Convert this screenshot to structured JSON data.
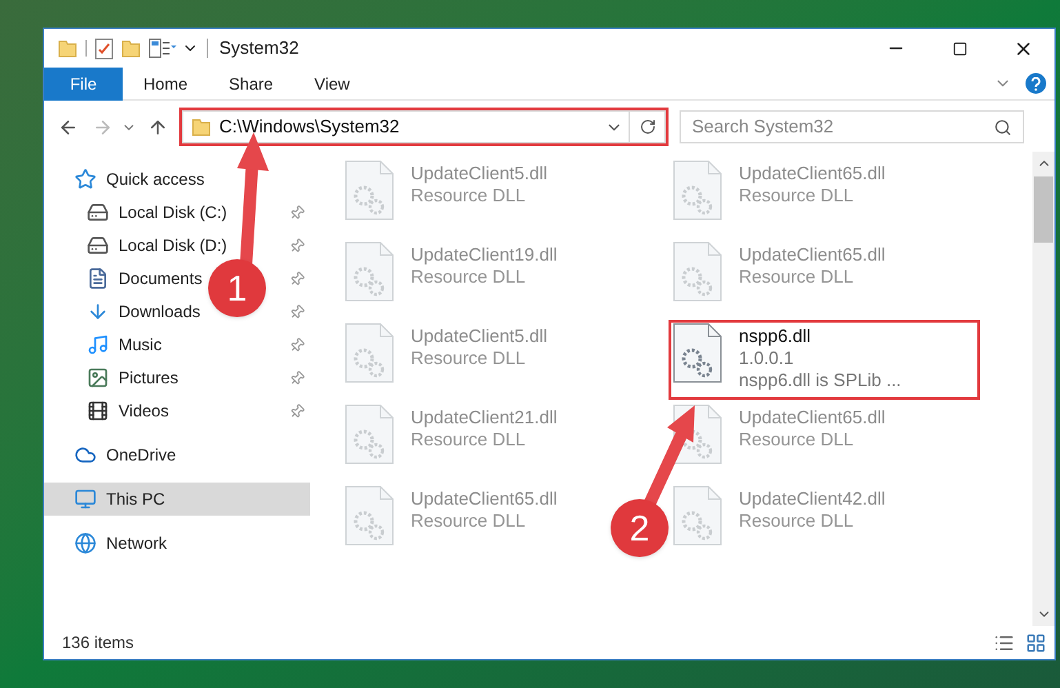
{
  "window": {
    "title": "System32"
  },
  "ribbon_tabs": [
    {
      "label": "File",
      "kind": "file"
    },
    {
      "label": "Home",
      "kind": "tab"
    },
    {
      "label": "Share",
      "kind": "tab"
    },
    {
      "label": "View",
      "kind": "tab"
    }
  ],
  "address_bar": {
    "value": "C:\\Windows\\System32",
    "highlighted": true
  },
  "search": {
    "placeholder": "Search System32"
  },
  "sidebar": {
    "items": [
      {
        "label": "Quick access",
        "kind": "star",
        "selected": false,
        "children": [
          {
            "label": "Local Disk (C:)",
            "kind": "system-drive",
            "pinned": true
          },
          {
            "label": "Local Disk (D:)",
            "kind": "drive",
            "pinned": true
          },
          {
            "label": "Documents",
            "kind": "document",
            "pinned": true
          },
          {
            "label": "Downloads",
            "kind": "download",
            "pinned": true
          },
          {
            "label": "Music",
            "kind": "music",
            "pinned": true
          },
          {
            "label": "Pictures",
            "kind": "picture",
            "pinned": true
          },
          {
            "label": "Videos",
            "kind": "video",
            "pinned": true
          }
        ]
      },
      {
        "label": "OneDrive",
        "kind": "cloud",
        "selected": false
      },
      {
        "label": "This PC",
        "kind": "computer",
        "selected": true
      },
      {
        "label": "Network",
        "kind": "network",
        "selected": false
      }
    ]
  },
  "files": [
    {
      "name": "UpdateClient5.dll",
      "lines": [
        "Resource DLL"
      ],
      "blurred": true,
      "highlighted": false
    },
    {
      "name": "UpdateClient65.dll",
      "lines": [
        "Resource DLL"
      ],
      "blurred": true,
      "highlighted": false
    },
    {
      "name": "UpdateClient19.dll",
      "lines": [
        "Resource DLL"
      ],
      "blurred": true,
      "highlighted": false
    },
    {
      "name": "UpdateClient65.dll",
      "lines": [
        "Resource DLL"
      ],
      "blurred": true,
      "highlighted": false
    },
    {
      "name": "UpdateClient5.dll",
      "lines": [
        "Resource DLL"
      ],
      "blurred": true,
      "highlighted": false
    },
    {
      "name": "nspp6.dll",
      "lines": [
        "1.0.0.1",
        "nspp6.dll is SPLib ..."
      ],
      "blurred": false,
      "highlighted": true
    },
    {
      "name": "UpdateClient21.dll",
      "lines": [
        "Resource DLL"
      ],
      "blurred": true,
      "highlighted": false
    },
    {
      "name": "UpdateClient65.dll",
      "lines": [
        "Resource DLL"
      ],
      "blurred": true,
      "highlighted": false
    },
    {
      "name": "UpdateClient65.dll",
      "lines": [
        "Resource DLL"
      ],
      "blurred": true,
      "highlighted": false
    },
    {
      "name": "UpdateClient42.dll",
      "lines": [
        "Resource DLL"
      ],
      "blurred": true,
      "highlighted": false
    }
  ],
  "status_bar": {
    "item_count": "136 items"
  },
  "annotations": [
    {
      "label": "1"
    },
    {
      "label": "2"
    }
  ]
}
